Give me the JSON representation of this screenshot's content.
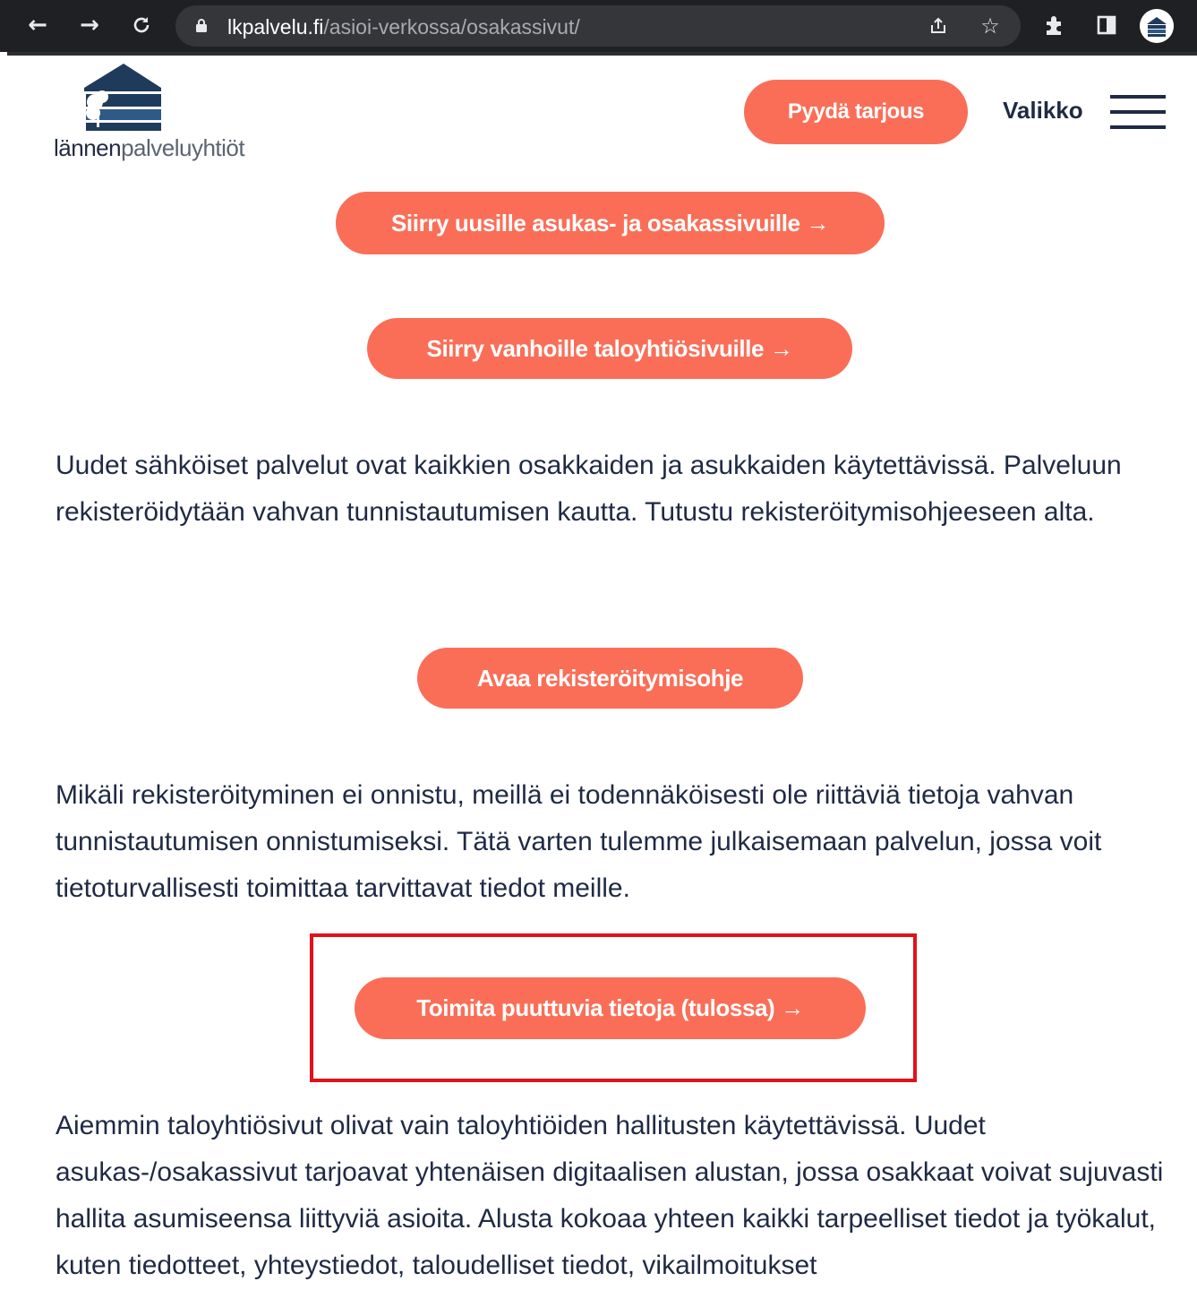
{
  "browser": {
    "url_domain": "lkpalvelu.fi",
    "url_path": "/asioi-verkossa/osakassivut/",
    "icons": [
      "back-arrow-icon",
      "forward-arrow-icon",
      "reload-icon",
      "lock-icon",
      "share-icon",
      "star-icon",
      "extensions-icon",
      "side-panel-icon",
      "profile-avatar"
    ]
  },
  "header": {
    "logo_part1": "lännen",
    "logo_part2": "palveluyhtiöt",
    "cta_label": "Pyydä tarjous",
    "menu_label": "Valikko"
  },
  "main": {
    "btn_new_pages": "Siirry uusille asukas- ja osakassivuille →",
    "btn_old_pages": "Siirry vanhoille taloyhtiösivuille →",
    "para1": "Uudet sähköiset palvelut ovat kaikkien osakkaiden ja asukkaiden käytettävissä. Palveluun rekisteröidytään vahvan tunnistautumisen kautta. Tutustu rekisteröitymisohjeeseen alta.",
    "btn_register_guide": "Avaa rekisteröitymisohje",
    "para2": "Mikäli rekisteröityminen ei onnistu, meillä ei todennäköisesti ole riittäviä tietoja vahvan tunnistautumisen onnistumiseksi. Tätä varten tulemme julkaisemaan palvelun, jossa voit tietoturvallisesti toimittaa tarvittavat tiedot meille.",
    "btn_missing_info": "Toimita puuttuvia tietoja (tulossa) →",
    "para3": "Aiemmin taloyhtiösivut olivat vain taloyhtiöiden hallitusten käytettävissä. Uudet asukas-/osakassivut tarjoavat yhtenäisen digitaalisen alustan, jossa osakkaat voivat sujuvasti hallita asumiseensa liittyviä asioita. Alusta kokoaa yhteen kaikki tarpeelliset tiedot ja työkalut, kuten tiedotteet, yhteystiedot, taloudelliset tiedot, vikailmoitukset"
  },
  "colors": {
    "accent": "#fa6e57",
    "text": "#1f2a44",
    "highlight_border": "#e2101b",
    "chrome_bg": "#1f2023"
  }
}
